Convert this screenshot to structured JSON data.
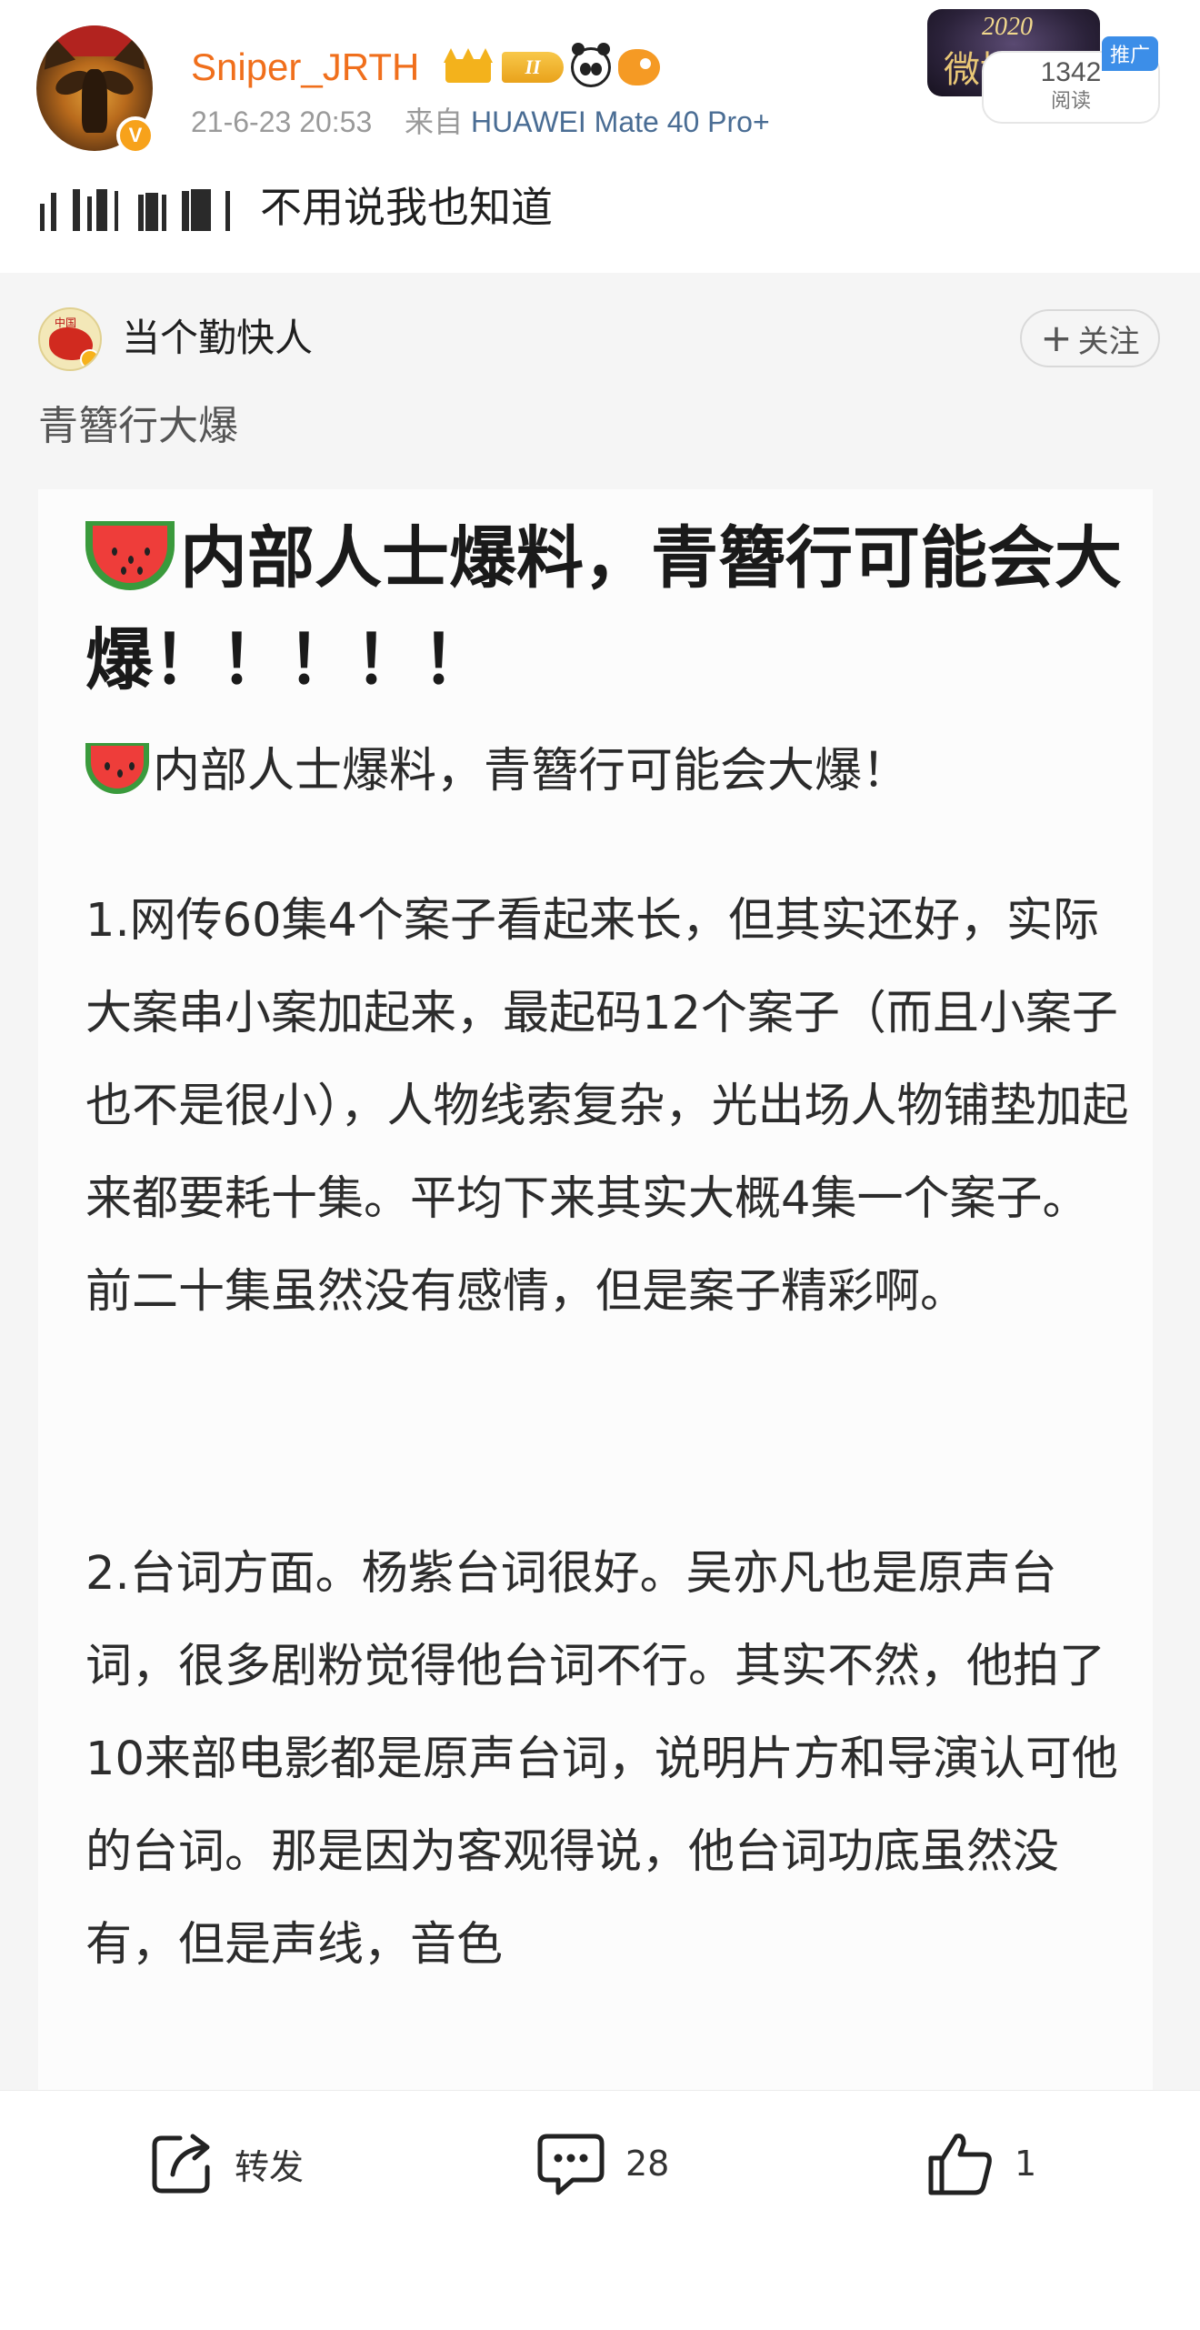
{
  "post": {
    "username": "Sniper_JRTH",
    "level_badge": "II",
    "time": "21-6-23 20:53",
    "source_prefix": "来自",
    "device": "HUAWEI Mate 40 Pro+",
    "body": "不用说我也知道",
    "verify_mark": "V"
  },
  "ad": {
    "tag": "推广",
    "banner_year": "2020",
    "banner_text": "微博之夜",
    "read_count": "1342",
    "read_label": "阅读"
  },
  "repost": {
    "username": "当个勤快人",
    "follow_label": "关注",
    "text": "青簪行大爆",
    "avatar_text": "中国",
    "article": {
      "title": "内部人士爆料，青簪行可能会大爆！！！！！",
      "subtitle": "内部人士爆料，青簪行可能会大爆！",
      "para1": "1.网传60集4个案子看起来长，但其实还好，实际大案串小案加起来，最起码12个案子（而且小案子也不是很小），人物线索复杂，光出场人物铺垫加起来都要耗十集。平均下来其实大概4集一个案子。前二十集虽然没有感情，但是案子精彩啊。",
      "para2": "2.台词方面。杨紫台词很好。吴亦凡也是原声台词，很多剧粉觉得他台词不行。其实不然，他拍了10来部电影都是原声台词，说明片方和导演认可他的台词。那是因为客观得说，他台词功底虽然没有，但是声线，音色"
    }
  },
  "actions": {
    "repost_label": "转发",
    "comment_count": "28",
    "like_count": "1"
  },
  "icons": [
    "repost-icon",
    "comment-icon",
    "like-icon",
    "plus-icon",
    "watermelon-icon",
    "crown-icon",
    "panda-icon",
    "fish-icon",
    "verified-icon"
  ],
  "colors": {
    "username": "#f06f1c",
    "device_link": "#4a6d94",
    "ad_tag": "#3c8ee8",
    "repost_bg": "#f5f5f5"
  }
}
